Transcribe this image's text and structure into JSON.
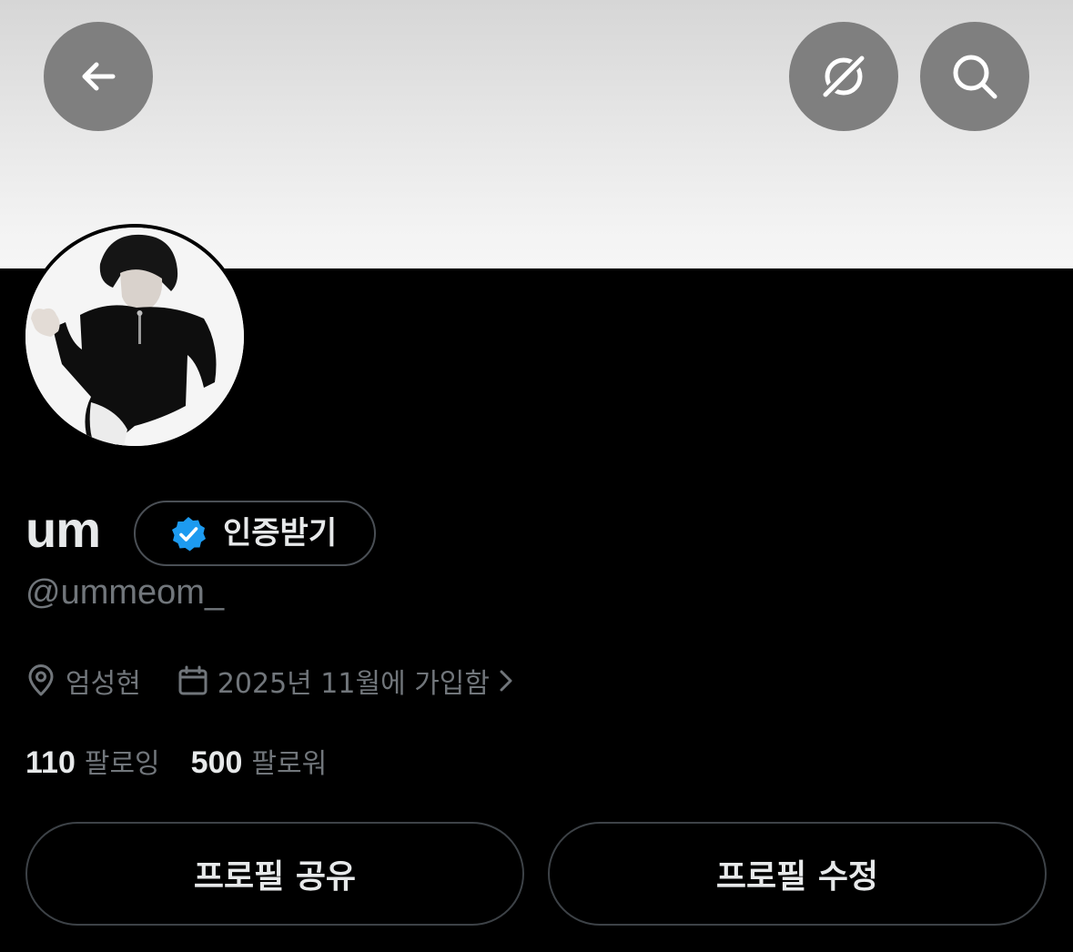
{
  "header": {
    "back_icon": "arrow-left-icon",
    "grok_icon": "grok-icon",
    "search_icon": "search-icon"
  },
  "profile": {
    "display_name": "um",
    "verify_label": "인증받기",
    "verify_badge_color": "#1d9bf0",
    "handle": "@ummeom_",
    "location": "엄성현",
    "joined": "2025년 11월에 가입함"
  },
  "stats": {
    "following_count": "110",
    "following_label": "팔로잉",
    "followers_count": "500",
    "followers_label": "팔로워"
  },
  "actions": {
    "share_label": "프로필 공유",
    "edit_label": "프로필 수정"
  },
  "colors": {
    "background": "#000000",
    "text_primary": "#e7e9ea",
    "text_secondary": "#71767b",
    "header_button": "#7f7f7f",
    "border": "#3d4247"
  }
}
